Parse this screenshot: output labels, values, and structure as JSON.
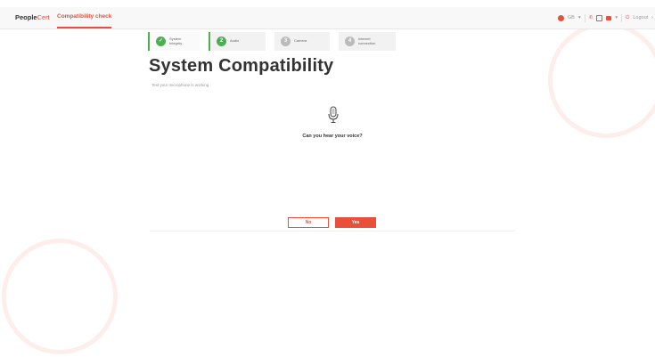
{
  "header": {
    "brand_main": "People",
    "brand_accent": "Cert",
    "active_tab": "Compatibility check",
    "language": "GB",
    "logout": "Logout"
  },
  "steps": [
    {
      "label": "System Integrity",
      "number": "",
      "state": "done"
    },
    {
      "label": "Audio",
      "number": "2",
      "state": "current"
    },
    {
      "label": "Camera",
      "number": "3",
      "state": "pending"
    },
    {
      "label": "Internet connection",
      "number": "4",
      "state": "pending"
    }
  ],
  "page": {
    "title": "System Compatibility",
    "subtitle": "Test your microphone is working"
  },
  "audio_test": {
    "question": "Can you hear your voice?",
    "no_label": "No",
    "yes_label": "Yes"
  },
  "colors": {
    "accent": "#e8503a",
    "success": "#4caf50"
  },
  "icons": {
    "mic": "microphone-icon",
    "check": "check-icon"
  }
}
